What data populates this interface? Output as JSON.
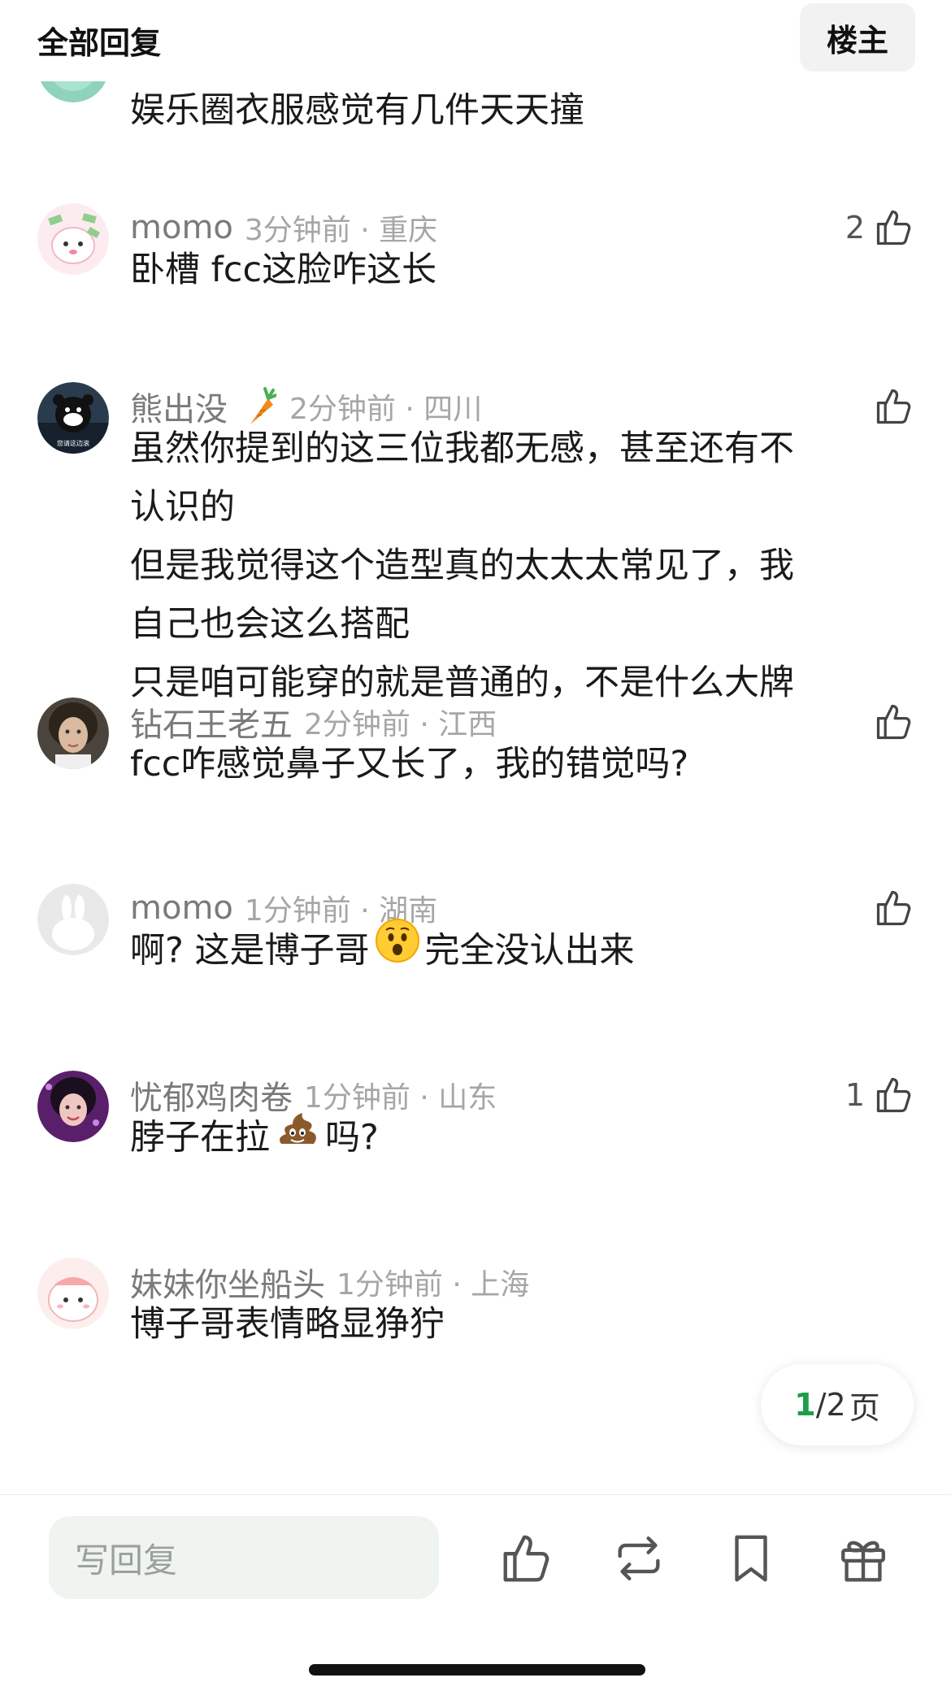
{
  "header": {
    "title": "全部回复",
    "op_button": "楼主"
  },
  "comments": [
    {
      "id": 0,
      "name": "",
      "time": "",
      "location": "",
      "lines": [
        "娱乐圈衣服感觉有几件天天撞"
      ],
      "likes": ""
    },
    {
      "id": 1,
      "name": "momo",
      "time": "3分钟前",
      "location": "重庆",
      "lines": [
        "卧槽 fcc这脸咋这长"
      ],
      "likes": "2"
    },
    {
      "id": 2,
      "name": "熊出没",
      "time": "2分钟前",
      "location": "四川",
      "badge": "carrot-icon",
      "avatar_text": "您请这边滚",
      "lines": [
        "虽然你提到的这三位我都无感，甚至还有不",
        "认识的",
        "但是我觉得这个造型真的太太太常见了，我",
        "自己也会这么搭配",
        "只是咱可能穿的就是普通的，不是什么大牌"
      ],
      "likes": ""
    },
    {
      "id": 3,
      "name": "钻石王老五",
      "time": "2分钟前",
      "location": "江西",
      "lines": [
        "fcc咋感觉鼻子又长了，我的错觉吗?"
      ],
      "likes": ""
    },
    {
      "id": 4,
      "name": "momo",
      "time": "1分钟前",
      "location": "湖南",
      "lines_pre": "啊? 这是博子哥",
      "emoji": "surprised-face-emoji",
      "lines_post": "完全没认出来",
      "likes": ""
    },
    {
      "id": 5,
      "name": "忧郁鸡肉卷",
      "time": "1分钟前",
      "location": "山东",
      "lines_pre": "脖子在拉",
      "emoji": "poop-emoji",
      "lines_post": "吗?",
      "likes": "1"
    },
    {
      "id": 6,
      "name": "妹妹你坐船头",
      "time": "1分钟前",
      "location": "上海",
      "lines": [
        "博子哥表情略显狰狞"
      ],
      "likes": ""
    }
  ],
  "separator": "·",
  "pager": {
    "current": "1",
    "total": "/2",
    "unit": "页",
    "current_color": "#1e9e4a"
  },
  "bottom_bar": {
    "reply_placeholder": "写回复",
    "icons": [
      "thumbs-up-icon",
      "repost-icon",
      "bookmark-icon",
      "gift-icon"
    ]
  },
  "colors": {
    "name": "#7a7a7a",
    "time": "#a6a6a6",
    "accent": "#1e9e4a",
    "input_bg": "#f0f4f1"
  }
}
